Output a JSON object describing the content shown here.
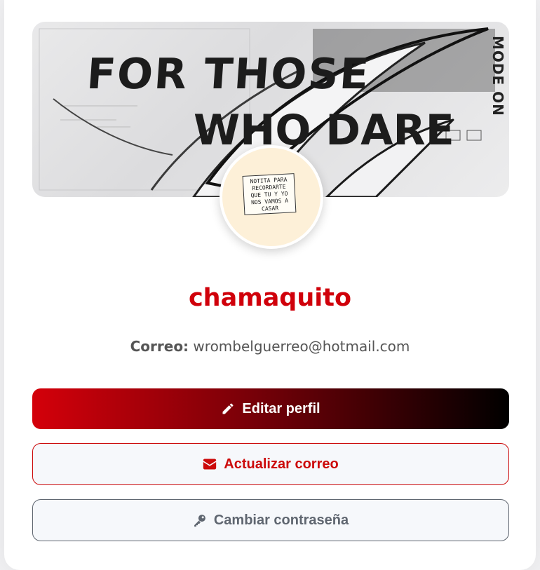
{
  "profile": {
    "username": "chamaquito",
    "email_label": "Correo:",
    "email_value": "wrombelguerreo@hotmail.com"
  },
  "banner": {
    "line1": "FOR THOSE",
    "line2": "WHO DARE",
    "side": "MODE ON"
  },
  "avatar": {
    "note_text": "NOTITA PARA RECORDARTE QUE TU Y YO NOS VAMOS A CASAR"
  },
  "actions": {
    "edit_label": "Editar perfil",
    "mail_label": "Actualizar correo",
    "password_label": "Cambiar contraseña"
  },
  "colors": {
    "accent": "#d0000b",
    "muted": "#5f6670"
  },
  "icons": {
    "edit": "pencil-icon",
    "mail": "envelope-icon",
    "password": "key-icon"
  }
}
